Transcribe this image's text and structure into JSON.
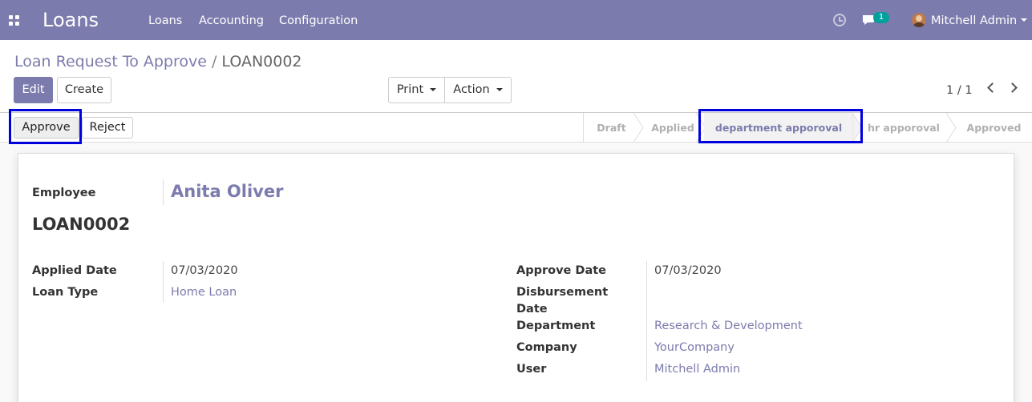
{
  "navbar": {
    "app_name": "Loans",
    "menu": [
      "Loans",
      "Accounting",
      "Configuration"
    ],
    "chat_count": "1",
    "user_name": "Mitchell Admin",
    "icons": [
      "apps-icon",
      "clock-icon",
      "chat-icon",
      "avatar",
      "chevron-down-icon"
    ]
  },
  "breadcrumb": {
    "parent": "Loan Request To Approve",
    "separator": " / ",
    "current": "LOAN0002"
  },
  "toolbar": {
    "edit_label": "Edit",
    "create_label": "Create",
    "print_label": "Print",
    "action_label": "Action",
    "pager": "1 / 1"
  },
  "statusbar": {
    "approve_label": "Approve",
    "reject_label": "Reject",
    "stages": [
      "Draft",
      "Applied",
      "department apporoval",
      "hr apporoval",
      "Approved"
    ],
    "active_stage": "department apporoval"
  },
  "form": {
    "employee_label": "Employee",
    "employee_value": "Anita Oliver",
    "loan_name": "LOAN0002",
    "applied_date_label": "Applied Date",
    "applied_date_value": "07/03/2020",
    "loan_type_label": "Loan Type",
    "loan_type_value": "Home Loan",
    "approve_date_label": "Approve Date",
    "approve_date_value": "07/03/2020",
    "disbursement_label_1": "Disbursement",
    "disbursement_label_2": "Date",
    "department_label": "Department",
    "department_value": "Research & Development",
    "company_label": "Company",
    "company_value": "YourCompany",
    "user_label": "User",
    "user_value": "Mitchell Admin"
  },
  "colors": {
    "brand": "#7c7bad",
    "highlight_box": "#0000dd",
    "badge": "#00a09d"
  }
}
